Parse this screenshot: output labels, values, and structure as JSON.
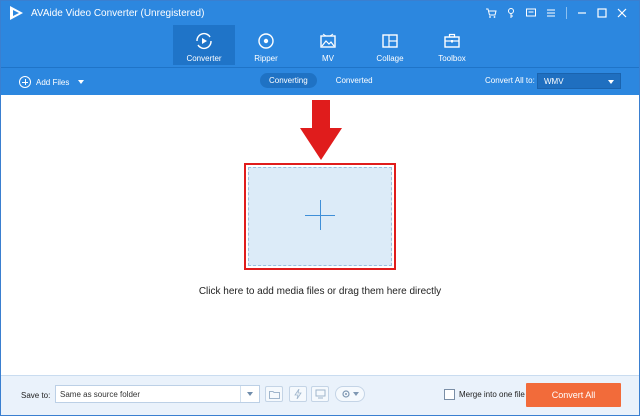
{
  "app": {
    "title": "AVAide Video Converter (Unregistered)",
    "logo_icon": "play-logo"
  },
  "window_controls": [
    "cart-icon",
    "key-icon",
    "feedback-icon",
    "menu-icon",
    "minimize-icon",
    "maximize-icon",
    "close-icon"
  ],
  "nav": {
    "items": [
      {
        "label": "Converter",
        "icon": "converter-icon",
        "active": true
      },
      {
        "label": "Ripper",
        "icon": "ripper-icon",
        "active": false
      },
      {
        "label": "MV",
        "icon": "mv-icon",
        "active": false
      },
      {
        "label": "Collage",
        "icon": "collage-icon",
        "active": false
      },
      {
        "label": "Toolbox",
        "icon": "toolbox-icon",
        "active": false
      }
    ]
  },
  "toolbar": {
    "add_files": "Add Files",
    "tabs": [
      {
        "label": "Converting",
        "active": true
      },
      {
        "label": "Converted",
        "active": false
      }
    ],
    "convert_all_label": "Convert All to:",
    "format_value": "WMV"
  },
  "main": {
    "hint": "Click here to add media files or drag them here directly"
  },
  "bottom": {
    "save_to_label": "Save to:",
    "save_path": "Same as source folder",
    "merge_label": "Merge into one file",
    "convert_all_button": "Convert All"
  },
  "colors": {
    "header_bg": "#2c87df",
    "accent_red": "#e01c1c",
    "convert_button": "#f26b3a",
    "drop_zone": "#dcebf8"
  }
}
